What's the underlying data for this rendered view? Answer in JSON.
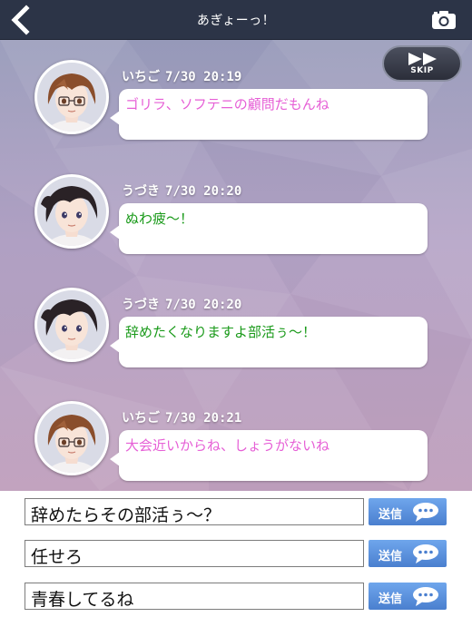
{
  "header": {
    "title": "あぎょーっ！",
    "back_icon": "chevron-left-icon",
    "camera_icon": "camera-icon",
    "background_color": "#2c3447"
  },
  "skip_button": {
    "label": "SKIP",
    "icon": "fast-forward-icon"
  },
  "messages": [
    {
      "sender": "いちご",
      "timestamp": "7/30 20:19",
      "text": "ゴリラ、ソフテニの顧問だもんね",
      "text_color": "#e65fd6",
      "avatar": "ichigo-avatar"
    },
    {
      "sender": "うづき",
      "timestamp": "7/30 20:20",
      "text": "ぬわ疲～！",
      "text_color": "#1a9a1a",
      "avatar": "uzuki-avatar"
    },
    {
      "sender": "うづき",
      "timestamp": "7/30 20:20",
      "text": "辞めたくなりますよ部活ぅ～！",
      "text_color": "#1a9a1a",
      "avatar": "uzuki-avatar"
    },
    {
      "sender": "いちご",
      "timestamp": "7/30 20:21",
      "text": "大会近いからね、しょうがないね",
      "text_color": "#e65fd6",
      "avatar": "ichigo-avatar"
    }
  ],
  "replies": [
    {
      "text": "辞めたらその部活ぅ～？",
      "send_label": "送信"
    },
    {
      "text": "任せろ",
      "send_label": "送信"
    },
    {
      "text": "青春してるね",
      "send_label": "送信"
    }
  ],
  "colors": {
    "send_button": "#4a7fcf",
    "bubble": "#ffffff"
  }
}
